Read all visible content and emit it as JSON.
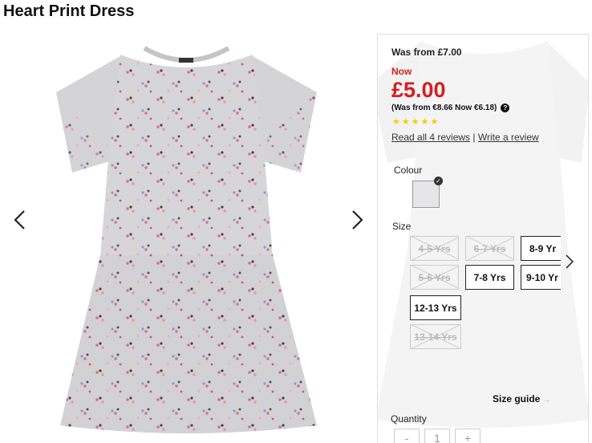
{
  "product": {
    "title": "Heart Print Dress"
  },
  "pricing": {
    "was": "Was from £7.00",
    "now_label": "Now",
    "price": "£5.00",
    "international": "(Was from €8.66 Now €6.18)"
  },
  "rating": {
    "stars": 5
  },
  "reviews": {
    "read_all": "Read all 4 reviews",
    "separator": "|",
    "write": "Write a review"
  },
  "colour": {
    "label": "Colour",
    "selected": "Grey",
    "swatch_color": "#e6e6e8"
  },
  "size": {
    "label": "Size",
    "options": [
      {
        "label": "4-5 Yrs",
        "available": false
      },
      {
        "label": "6-7 Yrs",
        "available": false
      },
      {
        "label": "8-9 Yr",
        "available": true
      },
      {
        "label": "5-6 Yrs",
        "available": false
      },
      {
        "label": "7-8 Yrs",
        "available": true
      },
      {
        "label": "9-10 Yr",
        "available": true
      },
      {
        "label": "12-13 Yrs",
        "available": true
      },
      {
        "label": "13-14 Yrs",
        "available": false
      }
    ],
    "guide": "Size guide"
  },
  "quantity": {
    "label": "Quantity",
    "minus": "-",
    "value": "1",
    "plus": "+"
  },
  "colors": {
    "sale_red": "#d51d20",
    "star_yellow": "#f2d000",
    "fabric_grey": "#d6d6d8"
  }
}
